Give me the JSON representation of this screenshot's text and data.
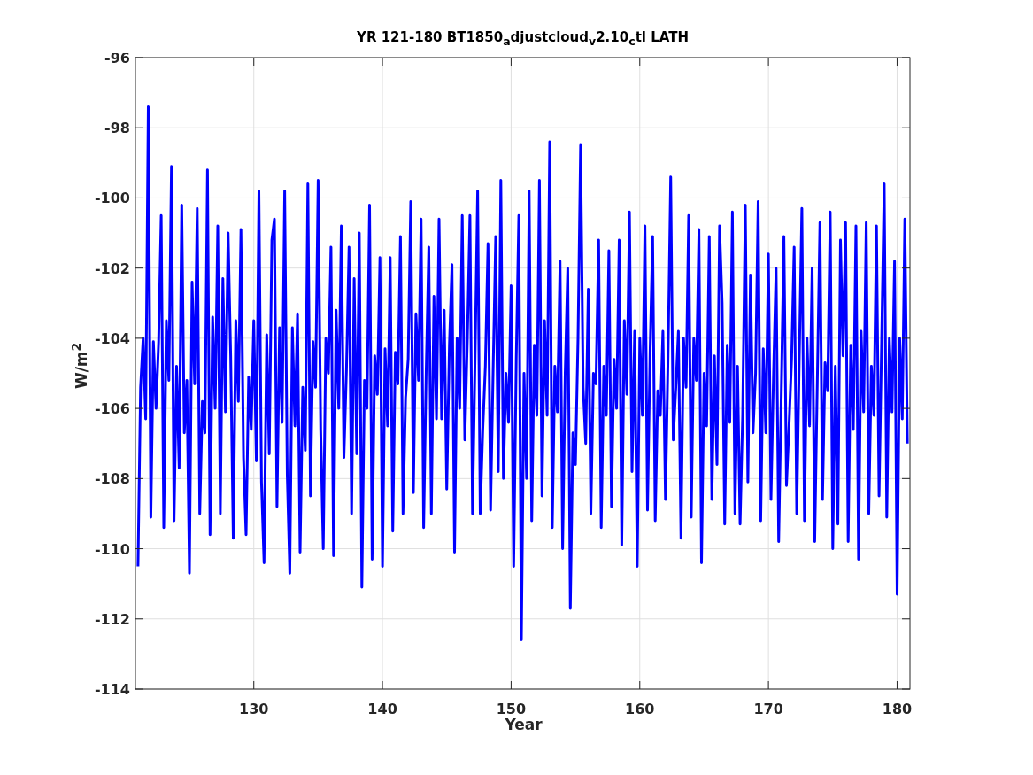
{
  "figure": {
    "chart_data": {
      "type": "line",
      "title": "YR 121-180 BT1850$_{a}$djustcloud$_{v}$2.10$_{c}$tl LATH",
      "xlabel": "Year",
      "ylabel": "W/m$^{2}$",
      "xlim": [
        120.8,
        181
      ],
      "ylim": [
        -114,
        -96
      ],
      "xticks": [
        130,
        140,
        150,
        160,
        170,
        180
      ],
      "yticks": [
        -114,
        -112,
        -110,
        -108,
        -106,
        -104,
        -102,
        -100,
        -98,
        -96
      ],
      "grid": true,
      "x": [
        121,
        121.2,
        121.4,
        121.6,
        121.8,
        122,
        122.2,
        122.4,
        122.6,
        122.8,
        123,
        123.2,
        123.4,
        123.6,
        123.8,
        124,
        124.2,
        124.4,
        124.6,
        124.8,
        125,
        125.2,
        125.4,
        125.6,
        125.8,
        126,
        126.2,
        126.4,
        126.6,
        126.8,
        127,
        127.2,
        127.4,
        127.6,
        127.8,
        128,
        128.2,
        128.4,
        128.6,
        128.8,
        129,
        129.2,
        129.4,
        129.6,
        129.8,
        130,
        130.2,
        130.4,
        130.6,
        130.8,
        131,
        131.2,
        131.4,
        131.6,
        131.8,
        132,
        132.2,
        132.4,
        132.6,
        132.8,
        133,
        133.2,
        133.4,
        133.6,
        133.8,
        134,
        134.2,
        134.4,
        134.6,
        134.8,
        135,
        135.2,
        135.4,
        135.6,
        135.8,
        136,
        136.2,
        136.4,
        136.6,
        136.8,
        137,
        137.2,
        137.4,
        137.6,
        137.8,
        138,
        138.2,
        138.4,
        138.6,
        138.8,
        139,
        139.2,
        139.4,
        139.6,
        139.8,
        140,
        140.2,
        140.4,
        140.6,
        140.8,
        141,
        141.2,
        141.4,
        141.6,
        141.8,
        142,
        142.2,
        142.4,
        142.6,
        142.8,
        143,
        143.2,
        143.4,
        143.6,
        143.8,
        144,
        144.2,
        144.4,
        144.6,
        144.8,
        145,
        145.2,
        145.4,
        145.6,
        145.8,
        146,
        146.2,
        146.4,
        146.6,
        146.8,
        147,
        147.2,
        147.4,
        147.6,
        147.8,
        148,
        148.2,
        148.4,
        148.6,
        148.8,
        149,
        149.2,
        149.4,
        149.6,
        149.8,
        150,
        150.2,
        150.4,
        150.6,
        150.8,
        151,
        151.2,
        151.4,
        151.6,
        151.8,
        152,
        152.2,
        152.4,
        152.6,
        152.8,
        153,
        153.2,
        153.4,
        153.6,
        153.8,
        154,
        154.2,
        154.4,
        154.6,
        154.8,
        155,
        155.2,
        155.4,
        155.6,
        155.8,
        156,
        156.2,
        156.4,
        156.6,
        156.8,
        157,
        157.2,
        157.4,
        157.6,
        157.8,
        158,
        158.2,
        158.4,
        158.6,
        158.8,
        159,
        159.2,
        159.4,
        159.6,
        159.8,
        160,
        160.2,
        160.4,
        160.6,
        160.8,
        161,
        161.2,
        161.4,
        161.6,
        161.8,
        162,
        162.2,
        162.4,
        162.6,
        162.8,
        163,
        163.2,
        163.4,
        163.6,
        163.8,
        164,
        164.2,
        164.4,
        164.6,
        164.8,
        165,
        165.2,
        165.4,
        165.6,
        165.8,
        166,
        166.2,
        166.4,
        166.6,
        166.8,
        167,
        167.2,
        167.4,
        167.6,
        167.8,
        168,
        168.2,
        168.4,
        168.6,
        168.8,
        169,
        169.2,
        169.4,
        169.6,
        169.8,
        170,
        170.2,
        170.4,
        170.6,
        170.8,
        171,
        171.2,
        171.4,
        171.6,
        171.8,
        172,
        172.2,
        172.4,
        172.6,
        172.8,
        173,
        173.2,
        173.4,
        173.6,
        173.8,
        174,
        174.2,
        174.4,
        174.6,
        174.8,
        175,
        175.2,
        175.4,
        175.6,
        175.8,
        176,
        176.2,
        176.4,
        176.6,
        176.8,
        177,
        177.2,
        177.4,
        177.6,
        177.8,
        178,
        178.2,
        178.4,
        178.6,
        178.8,
        179,
        179.2,
        179.4,
        179.6,
        179.8,
        180,
        180.2,
        180.4,
        180.6,
        180.8
      ],
      "series": [
        {
          "color": "#0000ff",
          "values": [
            -110.5,
            -105.4,
            -104,
            -106.3,
            -97.4,
            -109.1,
            -104.1,
            -106,
            -104.1,
            -100.5,
            -109.4,
            -103.5,
            -105.2,
            -99.1,
            -109.2,
            -104.8,
            -107.7,
            -100.2,
            -106.7,
            -105.2,
            -110.7,
            -102.4,
            -105.3,
            -100.3,
            -109,
            -105.8,
            -106.7,
            -99.2,
            -109.6,
            -103.4,
            -106,
            -100.8,
            -109,
            -102.3,
            -106.1,
            -101,
            -104.5,
            -109.7,
            -103.5,
            -105.8,
            -100.9,
            -107.4,
            -109.6,
            -105.1,
            -106.6,
            -103.5,
            -107.5,
            -99.8,
            -108.1,
            -110.4,
            -103.9,
            -107.3,
            -101.2,
            -100.6,
            -108.8,
            -103.7,
            -106.4,
            -99.8,
            -107.9,
            -110.7,
            -103.7,
            -106.5,
            -103.3,
            -110.1,
            -105.4,
            -107.2,
            -99.6,
            -108.5,
            -104.1,
            -105.4,
            -99.5,
            -106.6,
            -110,
            -104,
            -105,
            -101.4,
            -110.2,
            -103.2,
            -106,
            -100.8,
            -107.4,
            -104.9,
            -101.4,
            -109,
            -102.3,
            -107.3,
            -101,
            -111.1,
            -105.2,
            -106,
            -100.2,
            -110.3,
            -104.5,
            -105.6,
            -101.7,
            -110.5,
            -104.3,
            -106.5,
            -101.7,
            -109.5,
            -104.4,
            -105.3,
            -101.1,
            -109,
            -105.7,
            -104.6,
            -100.1,
            -108.4,
            -103.3,
            -105.2,
            -100.6,
            -109.4,
            -104.9,
            -101.4,
            -109,
            -102.8,
            -106.3,
            -100.6,
            -106.3,
            -103.2,
            -108.3,
            -104.2,
            -101.9,
            -110.1,
            -104,
            -106,
            -100.5,
            -106.9,
            -104,
            -100.5,
            -109,
            -104.5,
            -99.8,
            -109,
            -106.6,
            -104.8,
            -101.3,
            -108.9,
            -104.9,
            -101.1,
            -107.8,
            -99.5,
            -108,
            -105,
            -106.4,
            -102.5,
            -110.5,
            -104.6,
            -100.5,
            -112.6,
            -105,
            -108,
            -99.8,
            -109.2,
            -104.2,
            -106.2,
            -99.5,
            -108.5,
            -103.5,
            -106.2,
            -98.4,
            -109.4,
            -104.8,
            -106.1,
            -101.8,
            -110,
            -105,
            -102,
            -111.7,
            -106.7,
            -107.6,
            -104,
            -98.5,
            -105.4,
            -107,
            -102.6,
            -109,
            -105,
            -105.3,
            -101.2,
            -109.4,
            -104.8,
            -106.2,
            -101.5,
            -108.8,
            -104.6,
            -106,
            -101.2,
            -109.9,
            -103.5,
            -105.6,
            -100.4,
            -107.8,
            -103.8,
            -110.5,
            -104,
            -106.2,
            -100.8,
            -108.9,
            -104.4,
            -101.1,
            -109.2,
            -105.5,
            -106.2,
            -103.8,
            -108.6,
            -104.5,
            -99.4,
            -106.9,
            -105.4,
            -103.8,
            -109.7,
            -104,
            -105.4,
            -100.5,
            -109.1,
            -104,
            -105.2,
            -100.9,
            -110.4,
            -105,
            -106.5,
            -101.1,
            -108.6,
            -104.5,
            -107.6,
            -100.8,
            -103,
            -109.3,
            -104.2,
            -106.4,
            -100.4,
            -109,
            -104.8,
            -109.3,
            -106.2,
            -100.2,
            -108.1,
            -102.2,
            -106.7,
            -105,
            -100.1,
            -109.2,
            -104.3,
            -106.7,
            -101.6,
            -108.6,
            -105,
            -102,
            -109.8,
            -105.5,
            -101.1,
            -108.2,
            -106.5,
            -104.6,
            -101.4,
            -109,
            -104.5,
            -100.3,
            -109.2,
            -104,
            -106.5,
            -102,
            -109.8,
            -105.3,
            -100.7,
            -108.6,
            -104.7,
            -105.5,
            -100.4,
            -110,
            -104.8,
            -109.3,
            -101.2,
            -104.5,
            -100.7,
            -109.8,
            -104.2,
            -106.6,
            -100.8,
            -110.3,
            -103.8,
            -106.1,
            -100.7,
            -109,
            -104.8,
            -106.2,
            -100.8,
            -108.5,
            -104.1,
            -99.6,
            -109.1,
            -104,
            -106.1,
            -101.8,
            -111.3,
            -104,
            -106.3,
            -100.6,
            -107
          ]
        }
      ]
    }
  }
}
